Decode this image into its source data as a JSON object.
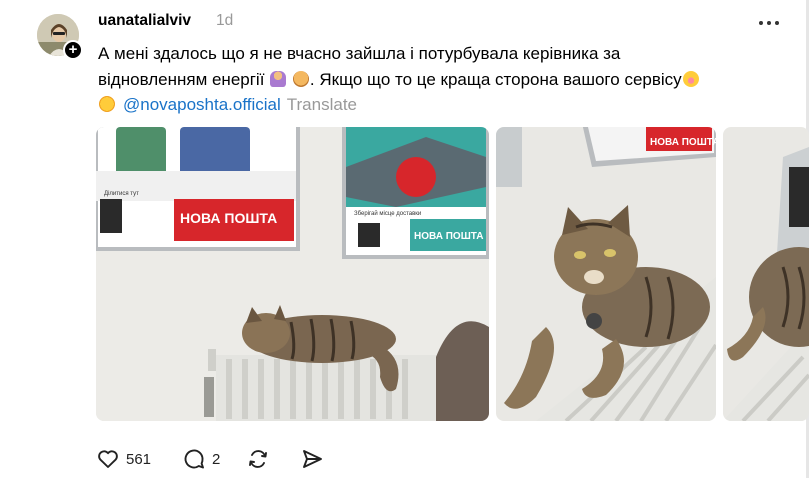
{
  "post": {
    "username": "uanatalialviv",
    "timestamp": "1d",
    "text_line1": "А мені здалось що я не вчасно зайшла і потурбувала керівника за",
    "text_line2a": "відновленням енергії",
    "text_line2b": ". Якщо що то це краща сторона вашого сервісу",
    "mention": "@novaposhta.official",
    "translate_label": "Translate",
    "brand_sign": "НОВА ПОШТА",
    "poster_caption": "Зберігай місце доставки",
    "poster_small": "Ділитися тут"
  },
  "actions": {
    "likes": "561",
    "replies": "2"
  },
  "icons": {
    "more": "more-horizontal-icon",
    "like": "heart-icon",
    "reply": "comment-icon",
    "repost": "repost-icon",
    "share": "send-icon",
    "follow": "plus-icon"
  },
  "colors": {
    "mention": "#1a73c8",
    "muted": "#999999",
    "brand_red": "#d7262b"
  }
}
